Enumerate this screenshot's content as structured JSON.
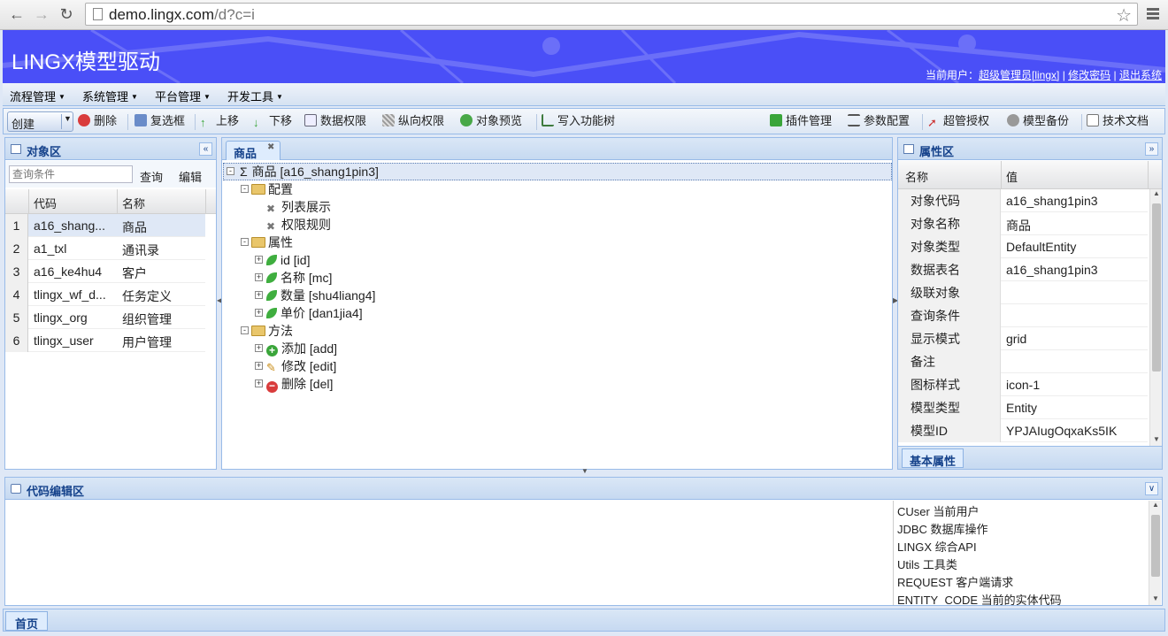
{
  "browser": {
    "url_host": "demo.lingx.com",
    "url_path": "/d?c=i"
  },
  "header": {
    "title": "LINGX模型驱动",
    "user_prefix": "当前用户：",
    "user_name": "超级管理员[lingx]",
    "sep1": "|",
    "change_password": "修改密码",
    "sep2": "|",
    "logout": "退出系统",
    "bg_color": "#4a4ff7"
  },
  "menu": [
    {
      "label": "流程管理"
    },
    {
      "label": "系统管理"
    },
    {
      "label": "平台管理"
    },
    {
      "label": "开发工具"
    }
  ],
  "toolbar": {
    "create": "创建",
    "delete": "删除",
    "checkbox": "复选框",
    "move_up": "上移",
    "move_down": "下移",
    "data_perm": "数据权限",
    "vertical_perm": "纵向权限",
    "preview": "对象预览",
    "write_func_tree": "写入功能树",
    "plugins": "插件管理",
    "params": "参数配置",
    "super_auth": "超管授权",
    "model_backup": "模型备份",
    "tech_docs": "技术文档"
  },
  "object_panel": {
    "title": "对象区",
    "search_placeholder": "查询条件",
    "search_btn": "查询",
    "edit_btn": "编辑",
    "col_code": "代码",
    "col_name": "名称",
    "rows": [
      {
        "num": "1",
        "code": "a16_shang...",
        "name": "商品"
      },
      {
        "num": "2",
        "code": "a1_txl",
        "name": "通讯录"
      },
      {
        "num": "3",
        "code": "a16_ke4hu4",
        "name": "客户"
      },
      {
        "num": "4",
        "code": "tlingx_wf_d...",
        "name": "任务定义"
      },
      {
        "num": "5",
        "code": "tlingx_org",
        "name": "组织管理"
      },
      {
        "num": "6",
        "code": "tlingx_user",
        "name": "用户管理"
      }
    ]
  },
  "tree_panel": {
    "tab": "商品",
    "root": "商品 [a16_shang1pin3]",
    "config": "配置",
    "list_display": "列表展示",
    "perm_rules": "权限规则",
    "attributes": "属性",
    "attr_items": [
      "id [id]",
      "名称 [mc]",
      "数量 [shu4liang4]",
      "单价 [dan1jia4]"
    ],
    "methods": "方法",
    "method_add": "添加 [add]",
    "method_edit": "修改 [edit]",
    "method_del": "删除 [del]"
  },
  "property_panel": {
    "title": "属性区",
    "col_name": "名称",
    "col_value": "值",
    "rows": [
      {
        "k": "对象代码",
        "v": "a16_shang1pin3"
      },
      {
        "k": "对象名称",
        "v": "商品"
      },
      {
        "k": "对象类型",
        "v": "DefaultEntity"
      },
      {
        "k": "数据表名",
        "v": "a16_shang1pin3"
      },
      {
        "k": "级联对象",
        "v": ""
      },
      {
        "k": "查询条件",
        "v": ""
      },
      {
        "k": "显示模式",
        "v": "grid"
      },
      {
        "k": "备注",
        "v": ""
      },
      {
        "k": "图标样式",
        "v": "icon-1"
      },
      {
        "k": "模型类型",
        "v": "Entity"
      },
      {
        "k": "模型ID",
        "v": "YPJAIugOqxaKs5IK"
      }
    ],
    "footer_tab": "基本属性"
  },
  "code_panel": {
    "title": "代码编辑区",
    "api_list": [
      "CUser 当前用户",
      "JDBC 数据库操作",
      "LINGX 综合API",
      "Utils 工具类",
      "REQUEST 客户端请求",
      "ENTITY_CODE 当前的实体代码"
    ]
  },
  "bottom_tabs": {
    "home": "首页"
  }
}
